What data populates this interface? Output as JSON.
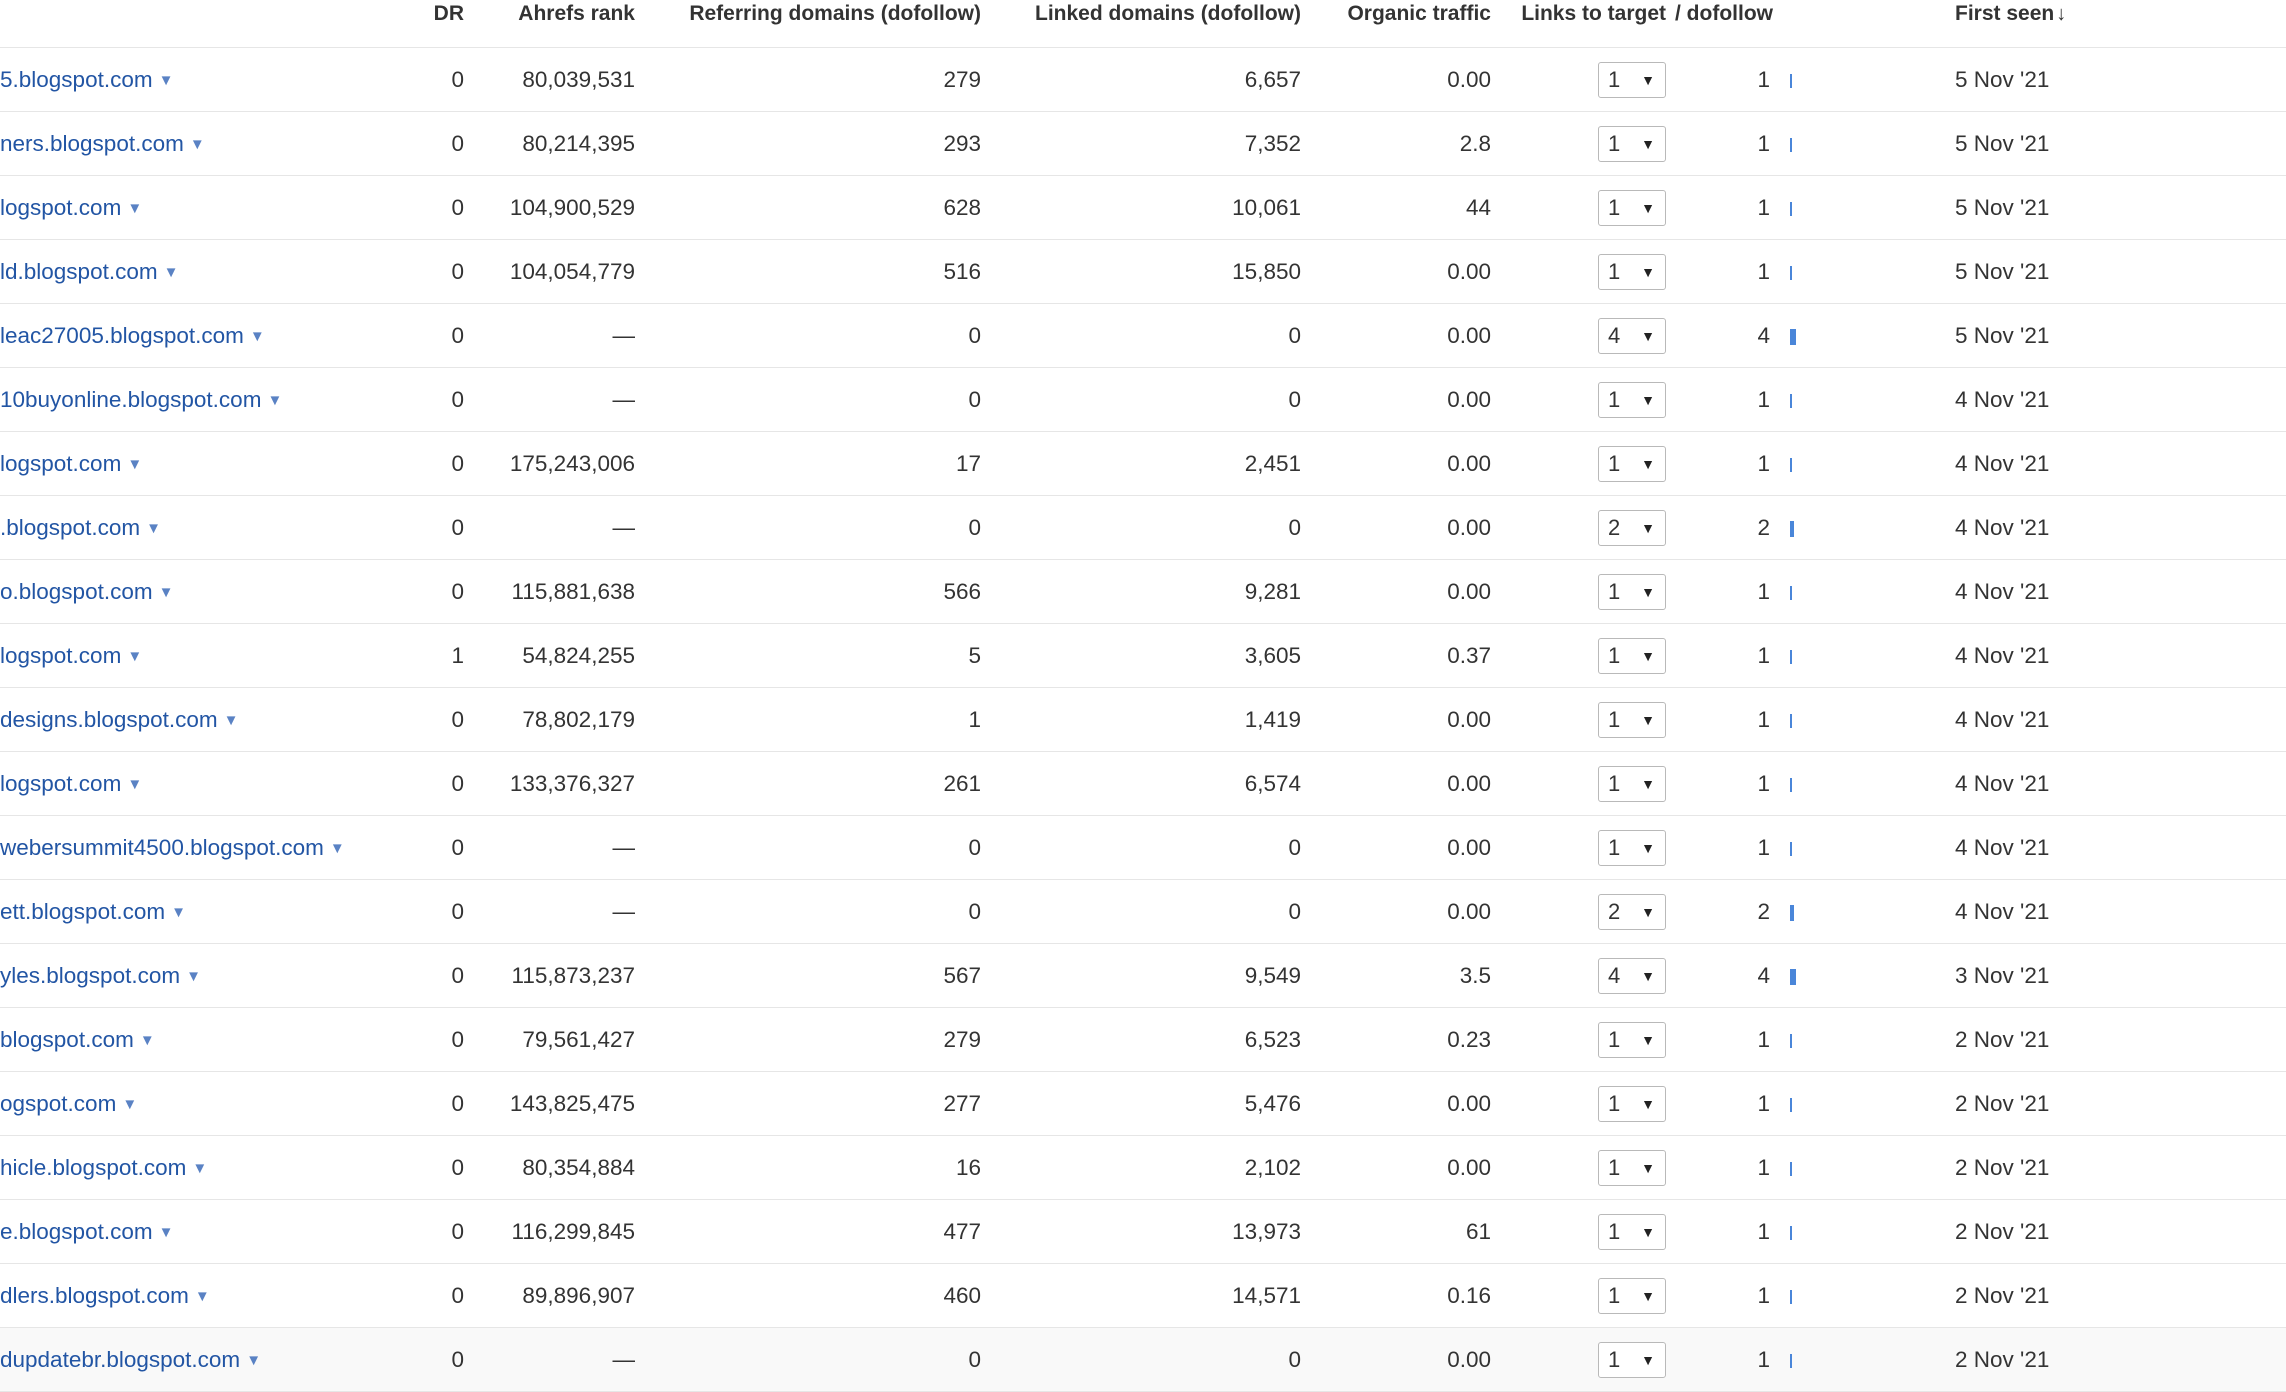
{
  "columns": {
    "dr": "DR",
    "ahrefs_rank": "Ahrefs rank",
    "ref_domains": "Referring domains (dofollow)",
    "linked_domains": "Linked domains (dofollow)",
    "organic_traffic": "Organic traffic",
    "links_to_target": "Links to target",
    "dofollow": "/ dofollow",
    "first_seen": "First seen",
    "first_seen_sort_icon": "sort-descending-arrow"
  },
  "colors": {
    "link": "#2255a4",
    "bar": "#4a86d9",
    "border": "#e6e6e6"
  },
  "rows": [
    {
      "domain": "5.blogspot.com",
      "dr": "0",
      "rank": "80,039,531",
      "ref": "279",
      "linked": "6,657",
      "traffic": "0.00",
      "links": "1",
      "dofollow": "1",
      "bar": 1,
      "first_seen": "5 Nov '21"
    },
    {
      "domain": "ners.blogspot.com",
      "dr": "0",
      "rank": "80,214,395",
      "ref": "293",
      "linked": "7,352",
      "traffic": "2.8",
      "links": "1",
      "dofollow": "1",
      "bar": 1,
      "first_seen": "5 Nov '21"
    },
    {
      "domain": "logspot.com",
      "dr": "0",
      "rank": "104,900,529",
      "ref": "628",
      "linked": "10,061",
      "traffic": "44",
      "links": "1",
      "dofollow": "1",
      "bar": 1,
      "first_seen": "5 Nov '21"
    },
    {
      "domain": "ld.blogspot.com",
      "dr": "0",
      "rank": "104,054,779",
      "ref": "516",
      "linked": "15,850",
      "traffic": "0.00",
      "links": "1",
      "dofollow": "1",
      "bar": 1,
      "first_seen": "5 Nov '21"
    },
    {
      "domain": "leac27005.blogspot.com",
      "dr": "0",
      "rank": "—",
      "ref": "0",
      "linked": "0",
      "traffic": "0.00",
      "links": "4",
      "dofollow": "4",
      "bar": 4,
      "first_seen": "5 Nov '21"
    },
    {
      "domain": "10buyonline.blogspot.com",
      "dr": "0",
      "rank": "—",
      "ref": "0",
      "linked": "0",
      "traffic": "0.00",
      "links": "1",
      "dofollow": "1",
      "bar": 1,
      "first_seen": "4 Nov '21"
    },
    {
      "domain": "logspot.com",
      "dr": "0",
      "rank": "175,243,006",
      "ref": "17",
      "linked": "2,451",
      "traffic": "0.00",
      "links": "1",
      "dofollow": "1",
      "bar": 1,
      "first_seen": "4 Nov '21"
    },
    {
      "domain": ".blogspot.com",
      "dr": "0",
      "rank": "—",
      "ref": "0",
      "linked": "0",
      "traffic": "0.00",
      "links": "2",
      "dofollow": "2",
      "bar": 2,
      "first_seen": "4 Nov '21"
    },
    {
      "domain": "o.blogspot.com",
      "dr": "0",
      "rank": "115,881,638",
      "ref": "566",
      "linked": "9,281",
      "traffic": "0.00",
      "links": "1",
      "dofollow": "1",
      "bar": 1,
      "first_seen": "4 Nov '21"
    },
    {
      "domain": "logspot.com",
      "dr": "1",
      "rank": "54,824,255",
      "ref": "5",
      "linked": "3,605",
      "traffic": "0.37",
      "links": "1",
      "dofollow": "1",
      "bar": 1,
      "first_seen": "4 Nov '21"
    },
    {
      "domain": "designs.blogspot.com",
      "dr": "0",
      "rank": "78,802,179",
      "ref": "1",
      "linked": "1,419",
      "traffic": "0.00",
      "links": "1",
      "dofollow": "1",
      "bar": 1,
      "first_seen": "4 Nov '21"
    },
    {
      "domain": "logspot.com",
      "dr": "0",
      "rank": "133,376,327",
      "ref": "261",
      "linked": "6,574",
      "traffic": "0.00",
      "links": "1",
      "dofollow": "1",
      "bar": 1,
      "first_seen": "4 Nov '21"
    },
    {
      "domain": "webersummit4500.blogspot.com",
      "dr": "0",
      "rank": "—",
      "ref": "0",
      "linked": "0",
      "traffic": "0.00",
      "links": "1",
      "dofollow": "1",
      "bar": 1,
      "first_seen": "4 Nov '21"
    },
    {
      "domain": "ett.blogspot.com",
      "dr": "0",
      "rank": "—",
      "ref": "0",
      "linked": "0",
      "traffic": "0.00",
      "links": "2",
      "dofollow": "2",
      "bar": 2,
      "first_seen": "4 Nov '21"
    },
    {
      "domain": "yles.blogspot.com",
      "dr": "0",
      "rank": "115,873,237",
      "ref": "567",
      "linked": "9,549",
      "traffic": "3.5",
      "links": "4",
      "dofollow": "4",
      "bar": 4,
      "first_seen": "3 Nov '21"
    },
    {
      "domain": "blogspot.com",
      "dr": "0",
      "rank": "79,561,427",
      "ref": "279",
      "linked": "6,523",
      "traffic": "0.23",
      "links": "1",
      "dofollow": "1",
      "bar": 1,
      "first_seen": "2 Nov '21"
    },
    {
      "domain": "ogspot.com",
      "dr": "0",
      "rank": "143,825,475",
      "ref": "277",
      "linked": "5,476",
      "traffic": "0.00",
      "links": "1",
      "dofollow": "1",
      "bar": 1,
      "first_seen": "2 Nov '21"
    },
    {
      "domain": "hicle.blogspot.com",
      "dr": "0",
      "rank": "80,354,884",
      "ref": "16",
      "linked": "2,102",
      "traffic": "0.00",
      "links": "1",
      "dofollow": "1",
      "bar": 1,
      "first_seen": "2 Nov '21"
    },
    {
      "domain": "e.blogspot.com",
      "dr": "0",
      "rank": "116,299,845",
      "ref": "477",
      "linked": "13,973",
      "traffic": "61",
      "links": "1",
      "dofollow": "1",
      "bar": 1,
      "first_seen": "2 Nov '21"
    },
    {
      "domain": "dlers.blogspot.com",
      "dr": "0",
      "rank": "89,896,907",
      "ref": "460",
      "linked": "14,571",
      "traffic": "0.16",
      "links": "1",
      "dofollow": "1",
      "bar": 1,
      "first_seen": "2 Nov '21"
    },
    {
      "domain": "dupdatebr.blogspot.com",
      "dr": "0",
      "rank": "—",
      "ref": "0",
      "linked": "0",
      "traffic": "0.00",
      "links": "1",
      "dofollow": "1",
      "bar": 1,
      "first_seen": "2 Nov '21"
    }
  ]
}
